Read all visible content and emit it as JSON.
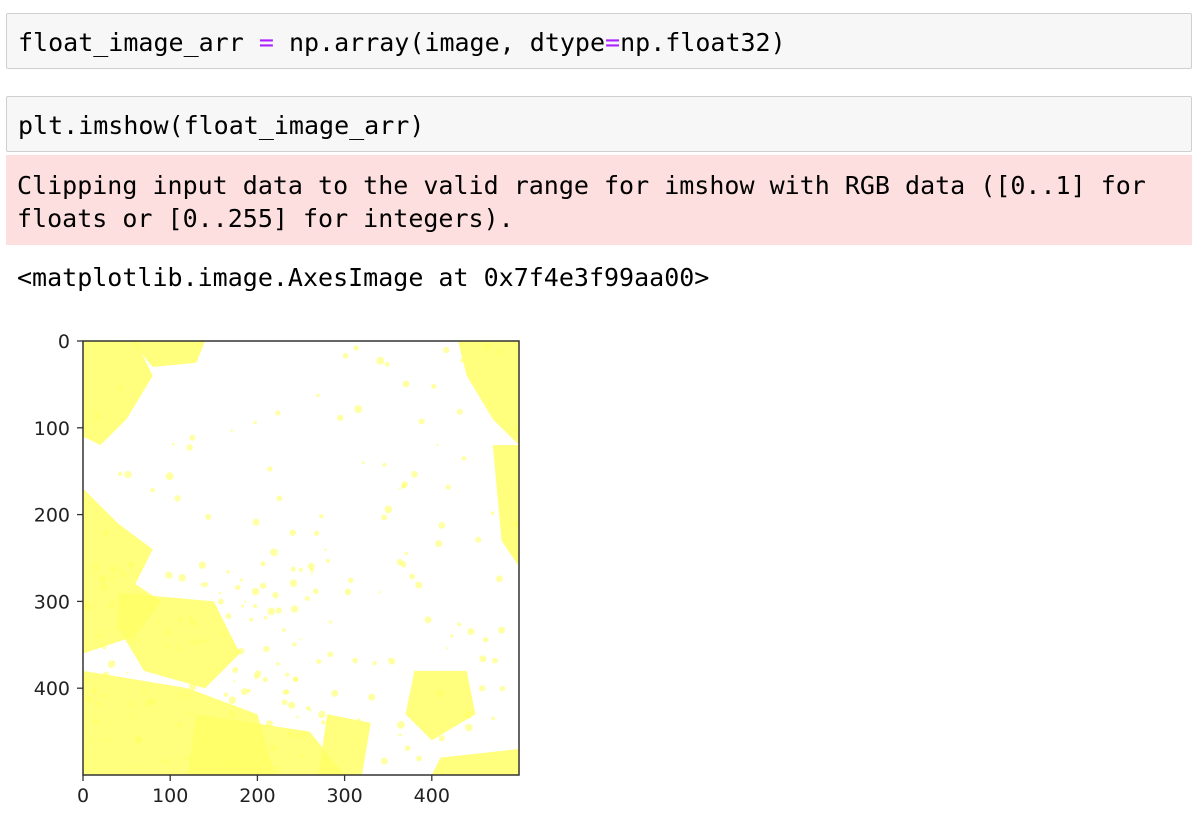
{
  "cells": [
    {
      "code_parts": [
        "float_image_arr ",
        "=",
        " np.array(image, dtype",
        "=",
        "np.float32)"
      ]
    },
    {
      "code": "plt.imshow(float_image_arr)"
    }
  ],
  "stderr": {
    "line1": "Clipping input data to the valid range for imshow with RGB data ([0..1] for",
    "line2": "floats or [0..255] for integers)."
  },
  "stdout": "<matplotlib.image.AxesImage at 0x7f4e3f99aa00>",
  "plot": {
    "colors": {
      "background": "#ffffff",
      "highlight": "#ffff66",
      "frame": "#333333"
    },
    "image_size": [
      500,
      500
    ]
  },
  "chart_data": {
    "type": "image",
    "title": "",
    "xlabel": "",
    "ylabel": "",
    "xlim": [
      0,
      500
    ],
    "ylim": [
      500,
      0
    ],
    "x_ticks": [
      0,
      100,
      200,
      300,
      400
    ],
    "y_ticks": [
      0,
      100,
      200,
      300,
      400
    ],
    "x_tick_labels": [
      "0",
      "100",
      "200",
      "300",
      "400"
    ],
    "y_tick_labels": [
      "0",
      "100",
      "200",
      "300",
      "400"
    ]
  }
}
